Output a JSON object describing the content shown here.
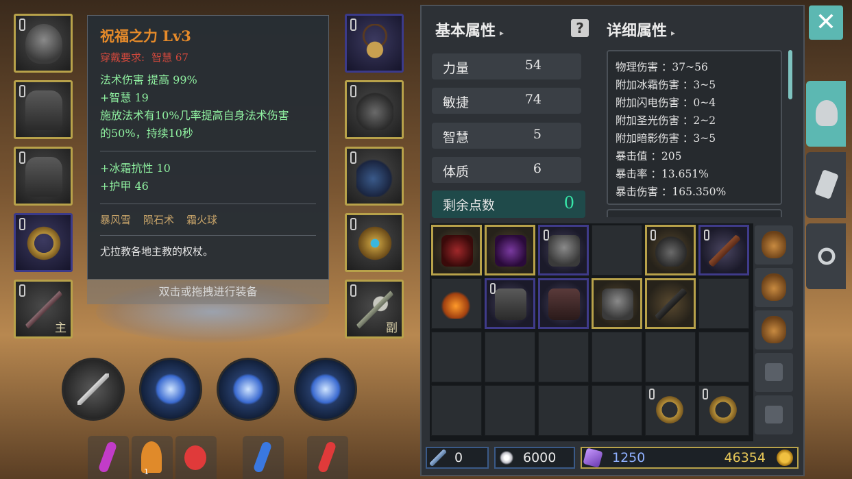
{
  "tooltip": {
    "title": "祝福之力 Lv3",
    "req_label": "穿戴要求:",
    "req_value": "智慧 67",
    "stats1": [
      "法术伤害 提高 99%",
      "+智慧 19",
      "施放法术有10%几率提高自身法术伤害",
      "的50%，持续10秒"
    ],
    "stats2": [
      "+冰霜抗性 10",
      "+护甲 46"
    ],
    "skills": [
      "暴风雪",
      "陨石术",
      "霜火球"
    ],
    "desc": "尤拉教各地主教的权杖。",
    "hint": "双击或拖拽进行装备"
  },
  "equip_tags": {
    "main": "主",
    "off": "副"
  },
  "panel": {
    "basic_title": "基本属性",
    "detail_title": "详细属性",
    "help": "?",
    "stats": [
      {
        "label": "力量",
        "value": "54"
      },
      {
        "label": "敏捷",
        "value": "74"
      },
      {
        "label": "智慧",
        "value": "5"
      },
      {
        "label": "体质",
        "value": "6"
      }
    ],
    "remaining": {
      "label": "剩余点数",
      "value": "0"
    },
    "details": [
      "物理伤害 ：37~56",
      "附加冰霜伤害 ：3~5",
      "附加闪电伤害 ：0~4",
      "附加圣光伤害 ：2~2",
      "附加暗影伤害 ：3~5",
      "暴击值 ：205",
      "暴击率 ：13.651%",
      "暴击伤害 ：165.350%"
    ]
  },
  "currency": {
    "crystal": "0",
    "gem": "6000",
    "soul": "1250",
    "gold": "46354"
  },
  "potions": {
    "campfire_count": "1"
  },
  "close": "✕",
  "colors": {
    "accent": "#5cb8b2",
    "legendary_border": "#b8a24a",
    "rare_border": "#3f3b8a",
    "tooltip_title": "#e58a2a",
    "stat_green": "#8ff0a0"
  }
}
